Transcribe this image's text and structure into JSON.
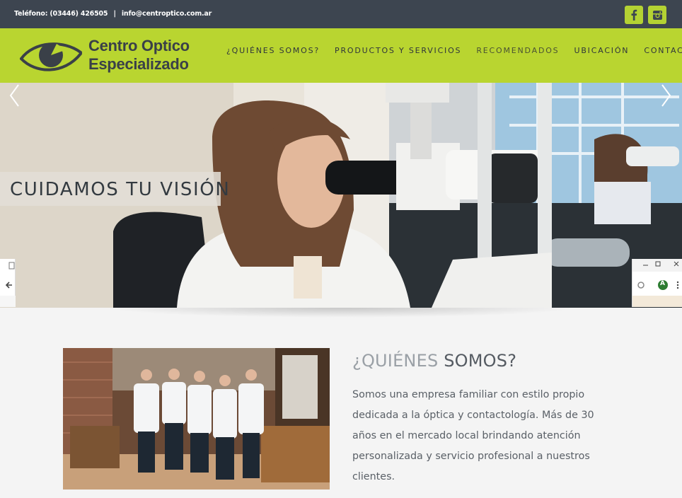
{
  "topbar": {
    "phone": "Teléfono: (03446) 426505",
    "separator": "|",
    "email": "info@centroptico.com.ar",
    "social": [
      {
        "name": "facebook",
        "glyph": "f"
      },
      {
        "name": "instagram",
        "glyph": "ig"
      }
    ]
  },
  "header": {
    "brand_line1": "Centro Optico",
    "brand_line2": "Especializado",
    "nav": [
      {
        "label": "¿QUIÉNES SOMOS?"
      },
      {
        "label": "PRODUCTOS Y SERVICIOS"
      },
      {
        "label": "RECOMENDADOS"
      },
      {
        "label": "UBICACIÓN"
      },
      {
        "label": "CONTACTO"
      }
    ]
  },
  "hero": {
    "caption": "CUIDAMOS TU VISIÓN",
    "prev_icon": "chevron-left-icon",
    "next_icon": "chevron-right-icon"
  },
  "about": {
    "title_part1": "¿QUIÉNES",
    "title_part2": "SOMOS?",
    "text": "Somos una empresa familiar con estilo propio dedicada a la óptica y contactología. Más de 30 años en el mercado local brindando atención personalizada y servicio profesional a nuestros clientes."
  },
  "browser_chrome": {
    "avatar_letter": "A"
  },
  "colors": {
    "topbar": "#3d4550",
    "accent": "#b9d530",
    "social_bg": "#b4d233",
    "text_dark": "#3a4048"
  }
}
